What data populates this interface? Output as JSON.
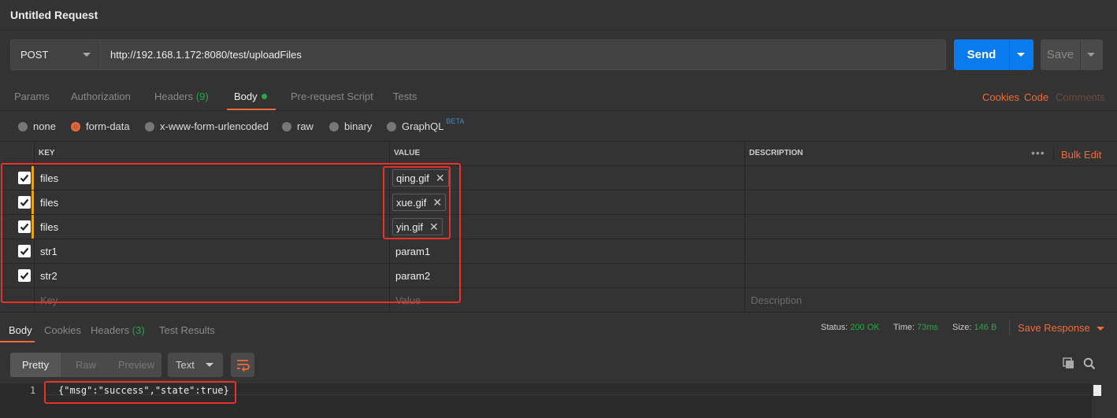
{
  "title": "Untitled Request",
  "request": {
    "method": "POST",
    "url": "http://192.168.1.172:8080/test/uploadFiles",
    "send_label": "Send",
    "save_label": "Save"
  },
  "tabs": [
    {
      "label": "Params"
    },
    {
      "label": "Authorization"
    },
    {
      "label": "Headers",
      "count": "(9)"
    },
    {
      "label": "Body"
    },
    {
      "label": "Pre-request Script"
    },
    {
      "label": "Tests"
    }
  ],
  "right_links": {
    "cookies": "Cookies",
    "code": "Code",
    "comments": "Comments"
  },
  "body_types": [
    "none",
    "form-data",
    "x-www-form-urlencoded",
    "raw",
    "binary",
    "GraphQL"
  ],
  "beta": "BETA",
  "selected_body_type": "form-data",
  "table": {
    "headers": {
      "key": "KEY",
      "value": "VALUE",
      "description": "DESCRIPTION"
    },
    "bulk_edit": "Bulk Edit",
    "rows": [
      {
        "key": "files",
        "value": "qing.gif",
        "type": "file",
        "checked": true
      },
      {
        "key": "files",
        "value": "xue.gif",
        "type": "file",
        "checked": true
      },
      {
        "key": "files",
        "value": "yin.gif",
        "type": "file",
        "checked": true
      },
      {
        "key": "str1",
        "value": "param1",
        "type": "text",
        "checked": true
      },
      {
        "key": "str2",
        "value": "param2",
        "type": "text",
        "checked": true
      }
    ],
    "placeholder": {
      "key": "Key",
      "value": "Value",
      "description": "Description"
    }
  },
  "response": {
    "tabs": [
      {
        "label": "Body"
      },
      {
        "label": "Cookies"
      },
      {
        "label": "Headers",
        "count": "(3)"
      },
      {
        "label": "Test Results"
      }
    ],
    "status_label": "Status:",
    "status_value": "200 OK",
    "time_label": "Time:",
    "time_value": "73ms",
    "size_label": "Size:",
    "size_value": "146 B",
    "save_response": "Save Response",
    "view_modes": [
      "Pretty",
      "Raw",
      "Preview"
    ],
    "format": "Text",
    "line_number": "1",
    "code": "{\"msg\":\"success\",\"state\":true}"
  },
  "colors": {
    "accent": "#f26b3a",
    "send": "#097bed",
    "status_ok": "#28a745",
    "annotation": "#e5322d"
  }
}
